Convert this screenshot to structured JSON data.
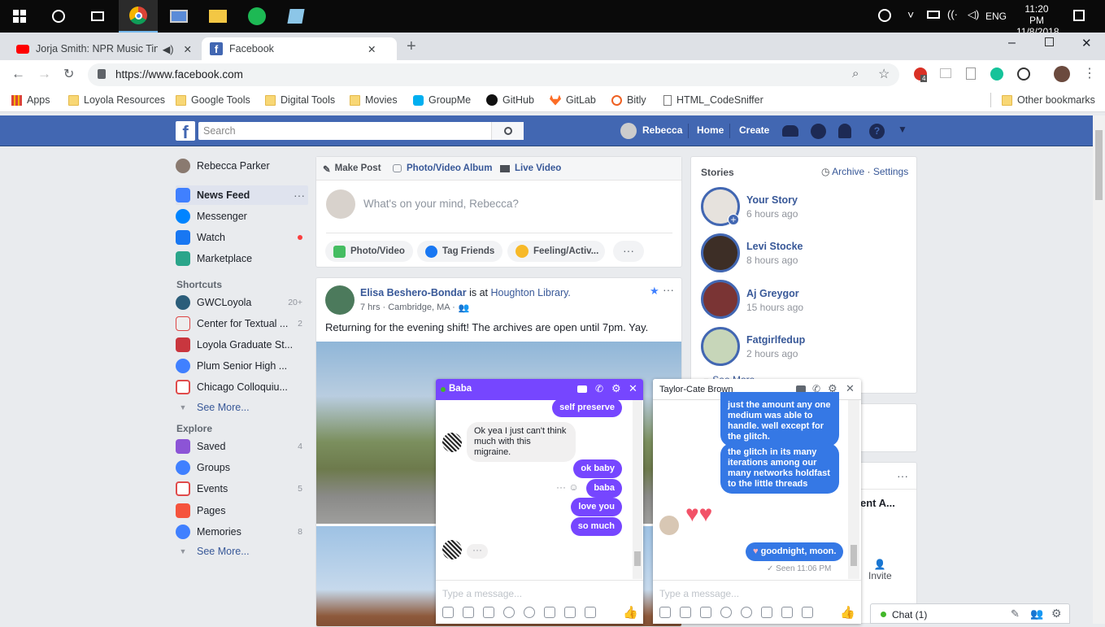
{
  "taskbar": {
    "time": "11:20 PM",
    "date": "11/8/2018",
    "lang": "ENG"
  },
  "tabs": [
    {
      "title": "Jorja Smith: NPR Music Tiny"
    },
    {
      "title": "Facebook"
    }
  ],
  "address": {
    "url": "https://www.facebook.com",
    "ext_badge": "4"
  },
  "bookmarks": [
    "Apps",
    "Loyola Resources",
    "Google Tools",
    "Digital Tools",
    "Movies",
    "GroupMe",
    "GitHub",
    "GitLab",
    "Bitly",
    "HTML_CodeSniffer",
    "Other bookmarks"
  ],
  "fbnav": {
    "search_placeholder": "Search",
    "user": "Rebecca",
    "home": "Home",
    "create": "Create"
  },
  "left": {
    "profile": "Rebecca Parker",
    "items": [
      {
        "label": "News Feed"
      },
      {
        "label": "Messenger"
      },
      {
        "label": "Watch"
      },
      {
        "label": "Marketplace"
      }
    ],
    "shortcuts_title": "Shortcuts",
    "shortcuts": [
      {
        "label": "GWCLoyola",
        "count": "20+"
      },
      {
        "label": "Center for Textual ...",
        "count": "2"
      },
      {
        "label": "Loyola Graduate St...",
        "count": ""
      },
      {
        "label": "Plum Senior High ...",
        "count": ""
      },
      {
        "label": "Chicago Colloquiu...",
        "count": ""
      }
    ],
    "see_more": "See More...",
    "explore_title": "Explore",
    "explore": [
      {
        "label": "Saved",
        "count": "4"
      },
      {
        "label": "Groups",
        "count": ""
      },
      {
        "label": "Events",
        "count": "5"
      },
      {
        "label": "Pages",
        "count": ""
      },
      {
        "label": "Memories",
        "count": "8"
      }
    ]
  },
  "composer": {
    "make_post": "Make Post",
    "album": "Photo/Video Album",
    "live": "Live Video",
    "placeholder": "What's on your mind, Rebecca?",
    "photo": "Photo/Video",
    "tag": "Tag Friends",
    "feeling": "Feeling/Activ..."
  },
  "post": {
    "author": "Elisa Beshero-Bondar",
    "is_at": " is at ",
    "place": "Houghton Library.",
    "meta": "7 hrs · Cambridge, MA ·",
    "text": "Returning for the evening shift! The archives are open until 7pm. Yay."
  },
  "stories": {
    "title": "Stories",
    "archive": "Archive",
    "settings": "Settings",
    "see_more": "See More",
    "items": [
      {
        "name": "Your Story",
        "time": "6 hours ago"
      },
      {
        "name": "Levi Stocke",
        "time": "8 hours ago"
      },
      {
        "name": "Aj Greygor",
        "time": "15 hours ago"
      },
      {
        "name": "Fatgirlfedup",
        "time": "2 hours ago"
      }
    ]
  },
  "right_partial": {
    "event_text": "ent A...",
    "invite": "Invite"
  },
  "chat_baba": {
    "name": "Baba",
    "messages": [
      {
        "text": "self preserve"
      },
      {
        "text": "Ok yea I just can't think much with this migraine."
      },
      {
        "text": "ok baby"
      },
      {
        "text": "baba"
      },
      {
        "text": "love you"
      },
      {
        "text": "so much"
      }
    ],
    "placeholder": "Type a message..."
  },
  "chat_tcb": {
    "name": "Taylor-Cate Brown",
    "messages": [
      {
        "text": "just the amount any one medium was able to handle. well except for the glitch."
      },
      {
        "text": "the glitch in its many iterations among our many networks holdfast to the little threads"
      },
      {
        "text": "goodnight, moon."
      }
    ],
    "seen": "Seen 11:06 PM",
    "placeholder": "Type a message..."
  },
  "chatbar": {
    "label": "Chat (1)"
  },
  "colors": {
    "fb_blue": "#4267b2",
    "messenger_purple": "#7646ff",
    "messenger_blue": "#3578e5"
  }
}
